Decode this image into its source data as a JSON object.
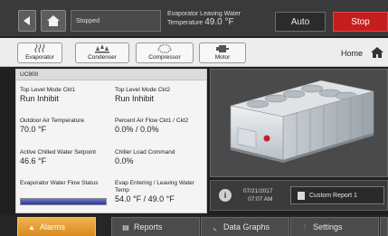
{
  "topbar": {
    "status": "Stopped",
    "evap_label": "Evaporator Leaving Water",
    "evap_temp_prefix": "Temperature",
    "evap_temp_value": "49.0 °F",
    "auto_label": "Auto",
    "stop_label": "Stop"
  },
  "components": {
    "tabs": [
      {
        "label": "Evaporator",
        "icon": "evaporator-icon"
      },
      {
        "label": "Condenser",
        "icon": "condenser-icon"
      },
      {
        "label": "Compressor",
        "icon": "compressor-icon"
      },
      {
        "label": "Motor",
        "icon": "motor-icon"
      }
    ],
    "home_label": "Home"
  },
  "panel": {
    "title": "UC800",
    "cells": [
      {
        "label": "Top Level Mode Ckt1",
        "value": "Run Inhibit"
      },
      {
        "label": "Top Level Mode Ckt2",
        "value": "Run Inhibit"
      },
      {
        "label": "Outdoor Air Temperature",
        "value": "70.0 °F"
      },
      {
        "label": "Percent Air Flow Ckt1 / Ckt2",
        "value": "0.0% / 0.0%"
      },
      {
        "label": "Active Chilled Water Setpoint",
        "value": "46.6 °F"
      },
      {
        "label": "Chiller Load Command",
        "value": "0.0%"
      },
      {
        "label": "Evaporator Water Flow Status",
        "value": ""
      },
      {
        "label": "Evap Entering / Leaving Water Temp",
        "value": "54.0 °F / 49.0 °F"
      }
    ],
    "flow_level": 1.0
  },
  "info": {
    "date": "07/21/2017",
    "time": "07:07 AM",
    "report_label": "Custom Report 1"
  },
  "nav": [
    {
      "label": "Alarms",
      "icon": "alarm-icon"
    },
    {
      "label": "Reports",
      "icon": "reports-icon"
    },
    {
      "label": "Data Graphs",
      "icon": "graph-icon"
    },
    {
      "label": "Settings",
      "icon": "settings-icon"
    }
  ],
  "colors": {
    "stop": "#c41e1e",
    "alarms": "#e3981f",
    "flow_bar": "#2e3ba3"
  }
}
